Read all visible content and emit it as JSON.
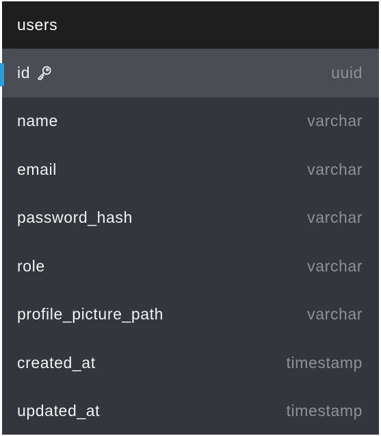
{
  "table": {
    "name": "users",
    "columns": [
      {
        "name": "id",
        "type": "uuid",
        "primary_key": true,
        "icon": "key-icon"
      },
      {
        "name": "name",
        "type": "varchar"
      },
      {
        "name": "email",
        "type": "varchar"
      },
      {
        "name": "password_hash",
        "type": "varchar"
      },
      {
        "name": "role",
        "type": "varchar"
      },
      {
        "name": "profile_picture_path",
        "type": "varchar"
      },
      {
        "name": "created_at",
        "type": "timestamp"
      },
      {
        "name": "updated_at",
        "type": "timestamp"
      }
    ]
  },
  "colors": {
    "header_bg": "#1e1e1e",
    "body_bg": "#35363d",
    "pk_row_bg": "#4b4d54",
    "name_text": "#f2f2f2",
    "type_text": "#8f9096",
    "connector": "#2d9cdb"
  }
}
